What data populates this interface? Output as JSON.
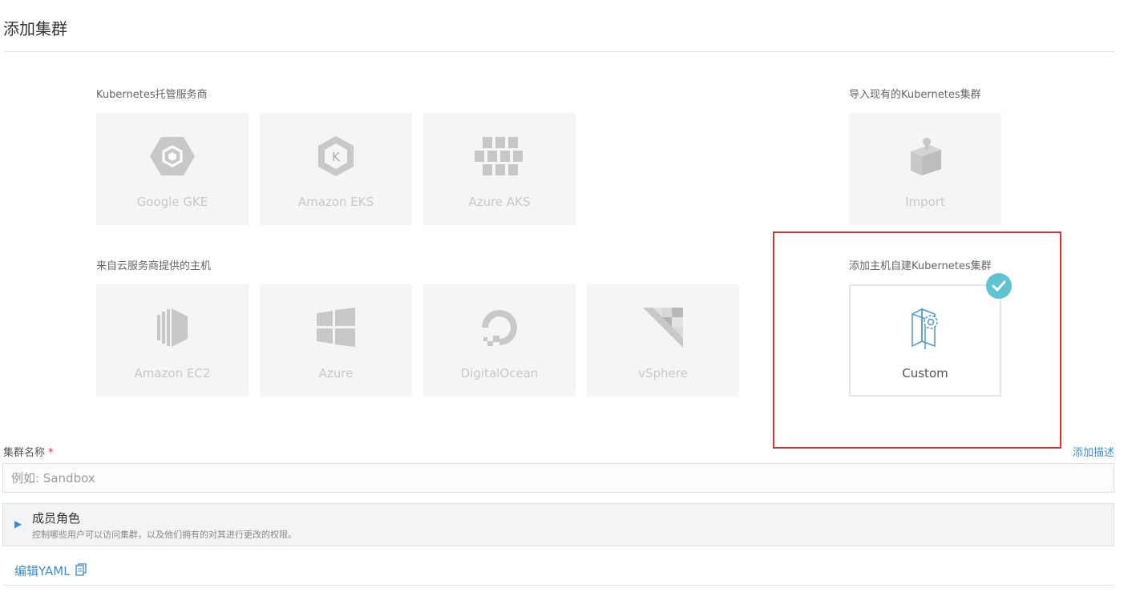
{
  "page": {
    "title": "添加集群"
  },
  "sections": {
    "hosted": "Kubernetes托管服务商",
    "import": "导入现有的Kubernetes集群",
    "cloud_hosts": "来自云服务商提供的主机",
    "custom": "添加主机自建Kubernetes集群"
  },
  "tiles": {
    "gke": {
      "label": "Google GKE",
      "icon": "gke-hexagon-icon"
    },
    "eks": {
      "label": "Amazon EKS",
      "icon": "eks-k-icon"
    },
    "aks": {
      "label": "Azure AKS",
      "icon": "aks-cubes-icon"
    },
    "import": {
      "label": "Import",
      "icon": "import-container-icon"
    },
    "ec2": {
      "label": "Amazon EC2",
      "icon": "ec2-icon"
    },
    "azure": {
      "label": "Azure",
      "icon": "windows-icon"
    },
    "digitalocean": {
      "label": "DigitalOcean",
      "icon": "digitalocean-icon"
    },
    "vsphere": {
      "label": "vSphere",
      "icon": "vsphere-icon"
    },
    "custom": {
      "label": "Custom",
      "icon": "custom-server-gear-icon",
      "selected": true
    }
  },
  "form": {
    "cluster_name_label": "集群名称",
    "required_mark": "*",
    "add_description": "添加描述",
    "cluster_name_placeholder": "例如: Sandbox",
    "cluster_name_value": ""
  },
  "members": {
    "title": "成员角色",
    "description": "控制哪些用户可以访问集群，以及他们拥有的对其进行更改的权限。"
  },
  "yaml": {
    "label": "编辑YAML",
    "icon": "copy-icon"
  },
  "colors": {
    "accent": "#3d8dcc",
    "check": "#5fc4d0",
    "highlight": "#e03030"
  }
}
